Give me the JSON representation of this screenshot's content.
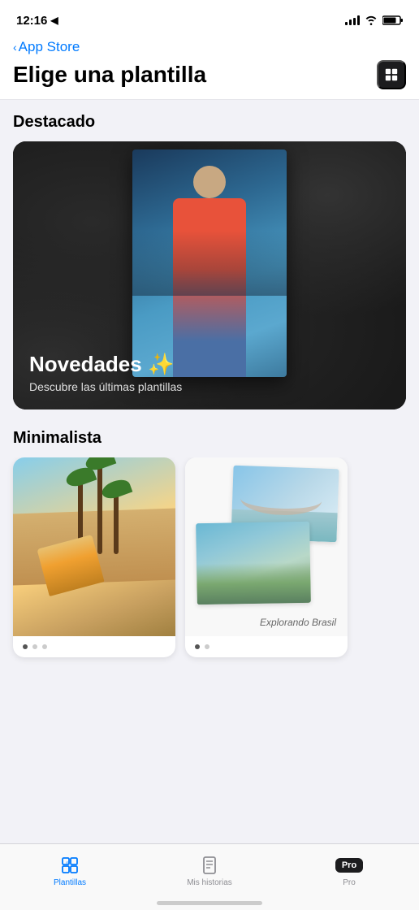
{
  "statusBar": {
    "time": "12:16",
    "locationArrow": "▶",
    "backLabel": "App Store"
  },
  "header": {
    "title": "Elige una plantilla",
    "iconAlt": "grid-icon"
  },
  "featured": {
    "sectionLabel": "Destacado",
    "cardHeadline": "Novedades ✨",
    "cardSubtitle": "Descubre las últimas plantillas"
  },
  "minimalista": {
    "sectionLabel": "Minimalista",
    "cards": [
      {
        "type": "skater",
        "caption": ""
      },
      {
        "type": "brazil",
        "caption": "Explorando Brasil"
      }
    ]
  },
  "tabBar": {
    "tabs": [
      {
        "id": "plantillas",
        "label": "Plantillas",
        "active": true
      },
      {
        "id": "historias",
        "label": "Mis historias",
        "active": false
      },
      {
        "id": "pro",
        "label": "Pro",
        "active": false,
        "isBadge": true,
        "badgeText": "Pro"
      }
    ]
  }
}
